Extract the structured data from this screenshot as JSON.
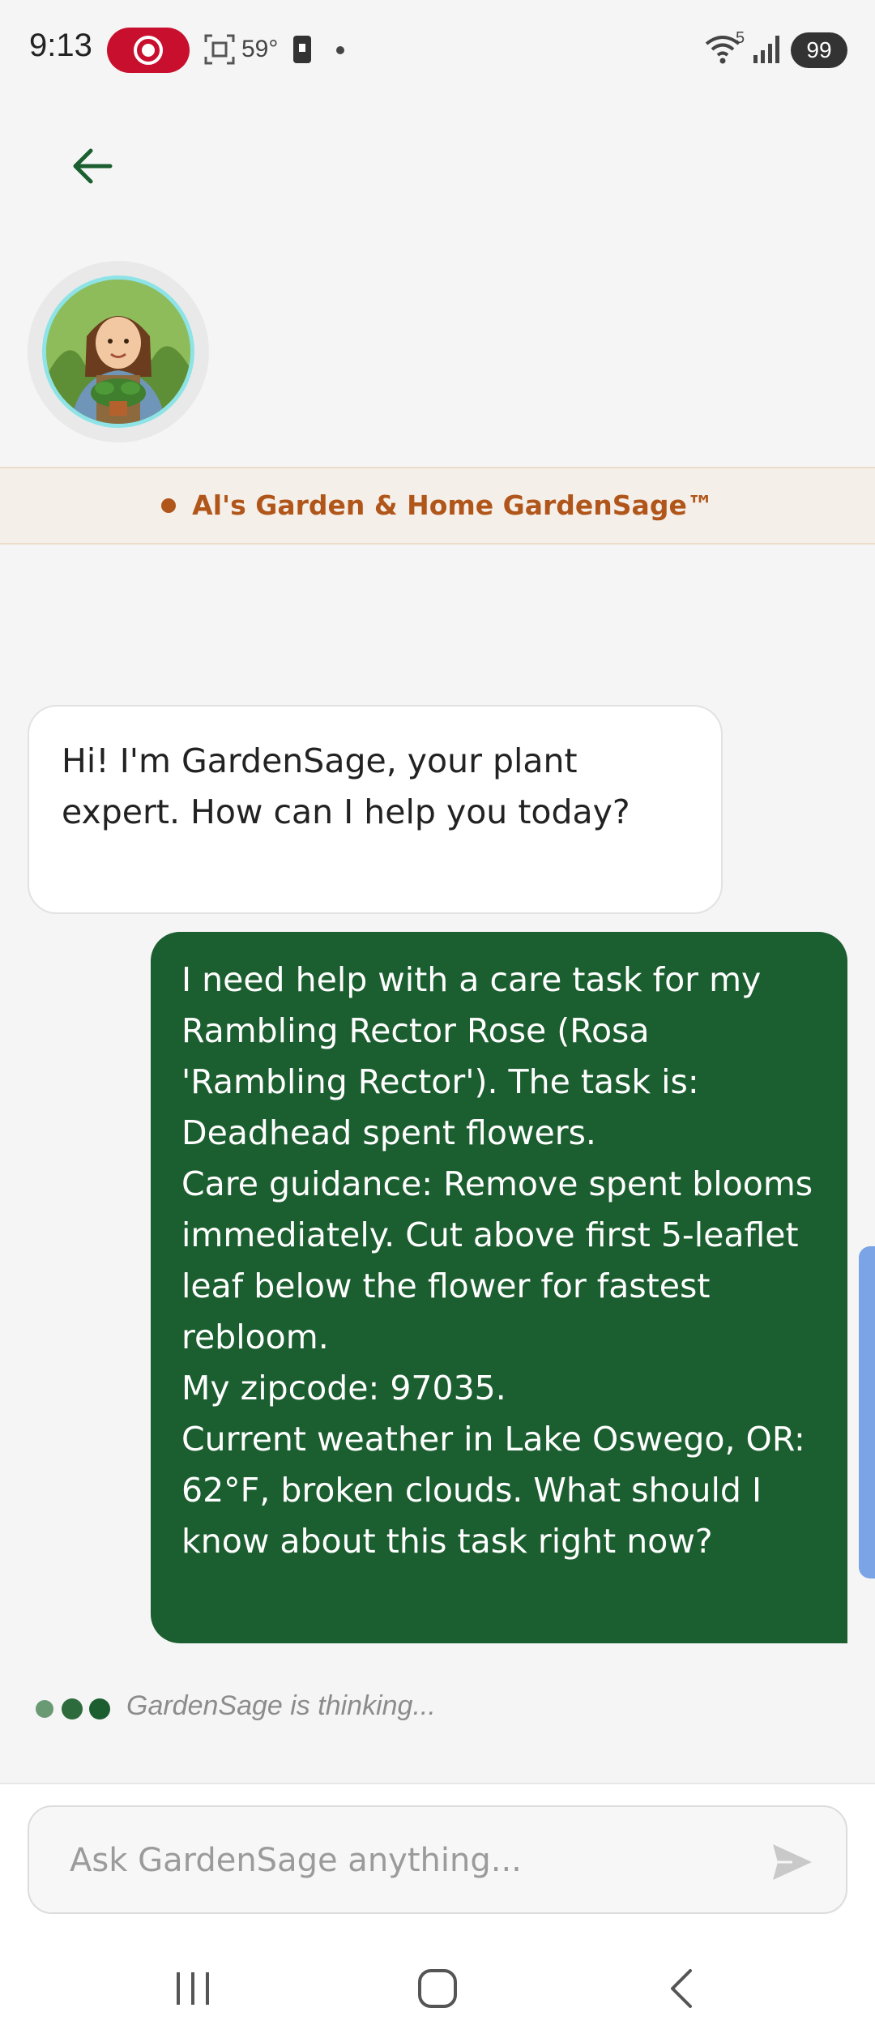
{
  "status_bar": {
    "time": "9:13",
    "temperature": "59°",
    "wifi_badge": "5",
    "battery": "99",
    "icons": [
      "screen-record-icon",
      "screenshot-icon",
      "phone-icon",
      "dot-icon",
      "wifi-icon",
      "signal-icon",
      "battery-icon"
    ]
  },
  "header": {
    "back_icon": "arrow-left-icon",
    "avatar_alt": "GardenSage avatar"
  },
  "brand": {
    "title": "Al's Garden & Home GardenSage™",
    "color": "#b1561a"
  },
  "chat": {
    "bot_greeting": "Hi! I'm GardenSage, your plant expert. How can I help you today?",
    "user_message": "I need help with a care task for my Rambling Rector Rose (Rosa 'Rambling Rector'). The task is: Deadhead spent flowers.\nCare guidance: Remove spent blooms immediately. Cut above first 5-leaflet leaf below the flower for fastest rebloom.\nMy zipcode: 97035.\nCurrent weather in Lake Oswego, OR: 62°F, broken clouds. What should I know about this task right now?",
    "thinking_text": "GardenSage is thinking...",
    "user_bubble_color": "#1b5e2f"
  },
  "input": {
    "placeholder": "Ask GardenSage anything...",
    "value": "",
    "send_icon": "send-icon"
  },
  "nav_bar": {
    "icons": [
      "recent-apps-icon",
      "home-icon",
      "back-icon"
    ]
  }
}
